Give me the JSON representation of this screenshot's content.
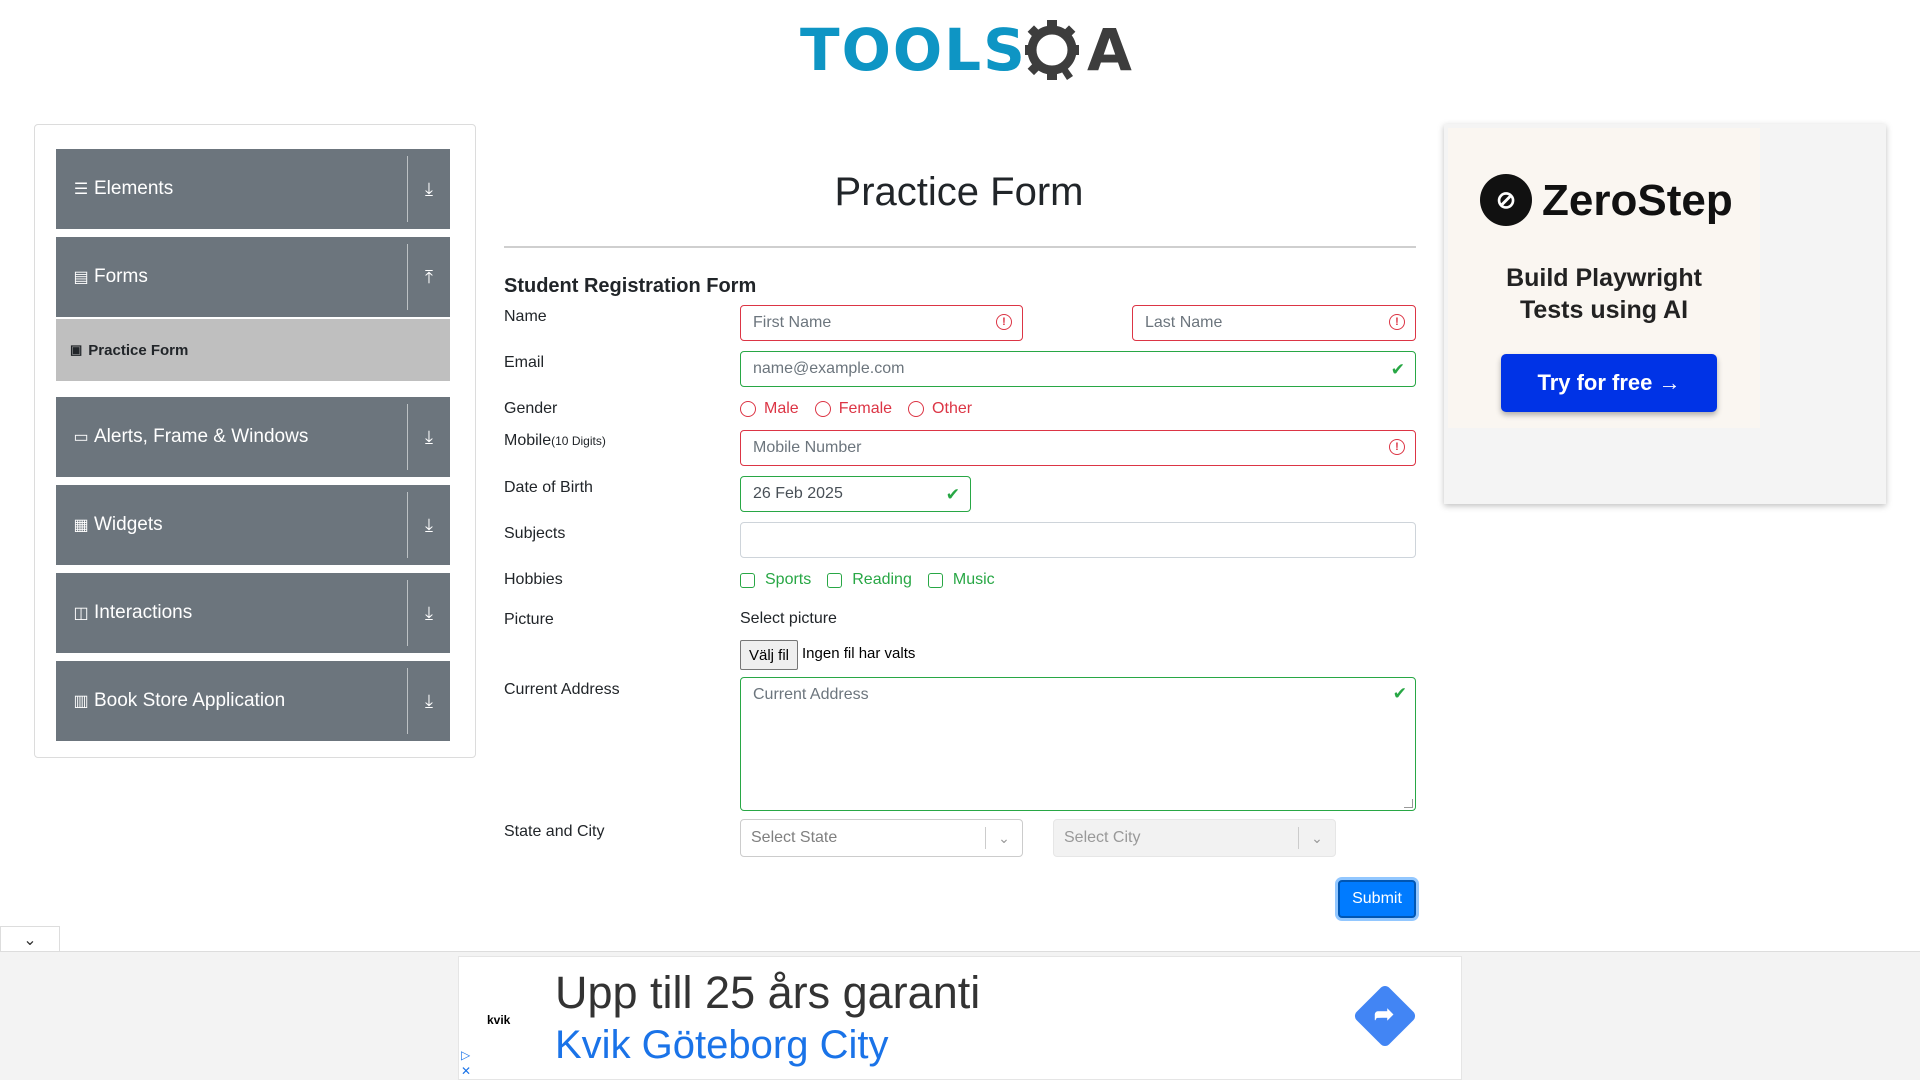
{
  "header": {
    "logo_tools": "TOOLS",
    "logo_qa": "QA"
  },
  "sidebar": {
    "groups": [
      {
        "label": "Elements",
        "icon": "hamburger-icon"
      },
      {
        "label": "Forms",
        "icon": "document-icon"
      },
      {
        "label": "Alerts, Frame & Windows",
        "icon": "window-icon"
      },
      {
        "label": "Widgets",
        "icon": "grid-icon"
      },
      {
        "label": "Interactions",
        "icon": "interaction-icon"
      },
      {
        "label": "Book Store Application",
        "icon": "books-icon"
      }
    ],
    "active_item": "Practice Form"
  },
  "main": {
    "page_title": "Practice Form",
    "form_title": "Student Registration Form",
    "labels": {
      "name": "Name",
      "email": "Email",
      "gender": "Gender",
      "mobile": "Mobile",
      "mobile_hint": "(10 Digits)",
      "dob": "Date of Birth",
      "subjects": "Subjects",
      "hobbies": "Hobbies",
      "picture": "Picture",
      "address": "Current Address",
      "state_city": "State and City"
    },
    "first_name_placeholder": "First Name",
    "last_name_placeholder": "Last Name",
    "email_placeholder": "name@example.com",
    "mobile_placeholder": "Mobile Number",
    "dob_value": "26 Feb 2025",
    "subjects_value": "",
    "gender_options": [
      "Male",
      "Female",
      "Other"
    ],
    "hobby_options": [
      "Sports",
      "Reading",
      "Music"
    ],
    "select_picture": "Select picture",
    "file_button": "Välj fil",
    "file_status": "Ingen fil har valts",
    "address_placeholder": "Current Address",
    "state_placeholder": "Select State",
    "city_placeholder": "Select City",
    "submit_label": "Submit",
    "colors": {
      "invalid": "#dc3545",
      "valid": "#28a745",
      "primary": "#007bff"
    }
  },
  "ad_right": {
    "brand": "ZeroStep",
    "tagline_line1": "Build Playwright",
    "tagline_line2": "Tests using AI",
    "cta": "Try for free →"
  },
  "ad_bottom": {
    "advertiser": "kvik",
    "headline": "Upp till 25 års garanti",
    "subline": "Kvik Göteborg City"
  }
}
